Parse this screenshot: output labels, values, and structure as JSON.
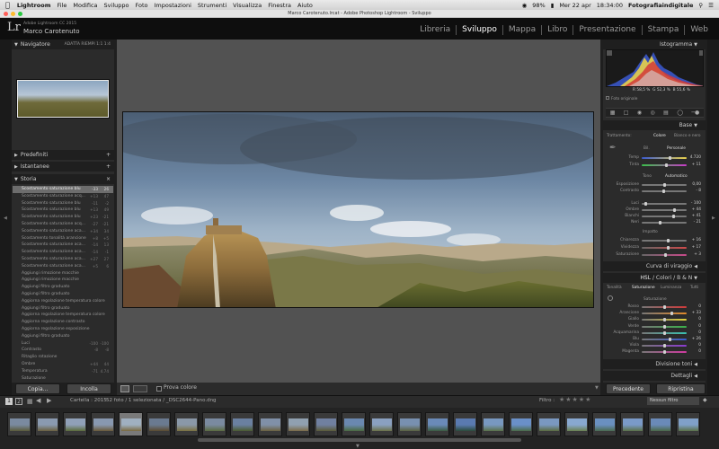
{
  "menubar": {
    "apple": "",
    "app": "Lightroom",
    "items": [
      "File",
      "Modifica",
      "Sviluppo",
      "Foto",
      "Impostazioni",
      "Strumenti",
      "Visualizza",
      "Finestra",
      "Aiuto"
    ],
    "right": {
      "battery": "98%",
      "date": "Mer 22 apr",
      "time": "18:34:00",
      "user": "Fotografiaindigitale"
    }
  },
  "window": {
    "title": "Marco Carotenuto.lrcat - Adobe Photoshop Lightroom - Sviluppo"
  },
  "identity": {
    "logo": "Lr",
    "version": "Adobe Lightroom CC 2015",
    "name": "Marco Carotenuto"
  },
  "modules": [
    "Libreria",
    "Sviluppo",
    "Mappa",
    "Libro",
    "Presentazione",
    "Stampa",
    "Web"
  ],
  "left": {
    "navigator": {
      "title": "Navigatore",
      "opts": "ADATTA  RIEMPI  1:1  1:4"
    },
    "presets": {
      "title": "Predefiniti"
    },
    "snapshots": {
      "title": "Istantanee"
    },
    "history": {
      "title": "Storia",
      "items": [
        {
          "label": "Scostamento saturazione blu",
          "v1": "-33",
          "v2": "26"
        },
        {
          "label": "Scostamento saturazione acq...",
          "v1": "+13",
          "v2": "47"
        },
        {
          "label": "Scostamento saturazione blu",
          "v1": "-11",
          "v2": "-2"
        },
        {
          "label": "Scostamento saturazione blu",
          "v1": "+13",
          "v2": "49"
        },
        {
          "label": "Scostamento saturazione blu",
          "v1": "+23",
          "v2": "-21"
        },
        {
          "label": "Scostamento saturazione acq...",
          "v1": "-27",
          "v2": "-21"
        },
        {
          "label": "Scostamento saturazione aca...",
          "v1": "+34",
          "v2": "34"
        },
        {
          "label": "Scostamento tonalità arancione",
          "v1": "+8",
          "v2": "+5"
        },
        {
          "label": "Scostamento saturazione aca...",
          "v1": "-14",
          "v2": "13"
        },
        {
          "label": "Scostamento saturazione aca...",
          "v1": "-14",
          "v2": "-1"
        },
        {
          "label": "Scostamento saturazione aca...",
          "v1": "+27",
          "v2": "27"
        },
        {
          "label": "Scostamento saturazione aca...",
          "v1": "+5",
          "v2": "6"
        },
        {
          "label": "Aggiungi rimozione macchie",
          "v1": "",
          "v2": ""
        },
        {
          "label": "Aggiungi rimozione macchie",
          "v1": "",
          "v2": ""
        },
        {
          "label": "Aggiungi filtro graduato",
          "v1": "",
          "v2": ""
        },
        {
          "label": "Aggiungi filtro graduato",
          "v1": "",
          "v2": ""
        },
        {
          "label": "Aggiorna regolazione temperatura colore",
          "v1": "",
          "v2": ""
        },
        {
          "label": "Aggiungi filtro graduato",
          "v1": "",
          "v2": ""
        },
        {
          "label": "Aggiorna regolazione temperatura colore",
          "v1": "",
          "v2": ""
        },
        {
          "label": "Aggiorna regolazione contrasto",
          "v1": "",
          "v2": ""
        },
        {
          "label": "Aggiorna regolazione esposizione",
          "v1": "",
          "v2": ""
        },
        {
          "label": "Aggiungi filtro graduato",
          "v1": "",
          "v2": ""
        },
        {
          "label": "Luci",
          "v1": "-100",
          "v2": "-100"
        },
        {
          "label": "Contrasto",
          "v1": "-8",
          "v2": "-8"
        },
        {
          "label": "Ritaglio rotazione",
          "v1": "",
          "v2": ""
        },
        {
          "label": "Ombre",
          "v1": "+44",
          "v2": "44"
        },
        {
          "label": "Temperatura",
          "v1": "-71",
          "v2": "4.74"
        },
        {
          "label": "Saturazione",
          "v1": "",
          "v2": ""
        }
      ]
    },
    "copy": "Copia...",
    "paste": "Incolla"
  },
  "toolbar": {
    "proof": "Prova colore"
  },
  "right": {
    "histogram": {
      "title": "Istogramma",
      "r": "58,5",
      "g": "52,3",
      "b": "55,6",
      "orig": "Foto originale"
    },
    "basic": {
      "title": "Base",
      "treatment": "Trattamento:",
      "color": "Colore",
      "bw": "Bianco e nero",
      "wb_label": "Bil.",
      "wb_value": "Personale",
      "temp": {
        "label": "Temp",
        "value": "4.720"
      },
      "tint": {
        "label": "Tinta",
        "value": "+ 11"
      },
      "tone_label": "Tono",
      "auto": "Automatico",
      "exposure": {
        "label": "Esposizione",
        "value": "0,00"
      },
      "contrast": {
        "label": "Contrasto",
        "value": "- 8"
      },
      "highlights": {
        "label": "Luci",
        "value": "- 100"
      },
      "shadows": {
        "label": "Ombre",
        "value": "+ 44"
      },
      "whites": {
        "label": "Bianchi",
        "value": "+ 41"
      },
      "blacks": {
        "label": "Neri",
        "value": "- 21"
      },
      "presence_label": "Impatto",
      "clarity": {
        "label": "Chiarezza",
        "value": "+ 16"
      },
      "vibrance": {
        "label": "Vividezza",
        "value": "+ 17"
      },
      "saturation": {
        "label": "Saturazione",
        "value": "+ 3"
      }
    },
    "curve": {
      "title": "Curva di viraggio"
    },
    "hsl": {
      "title_hsl": "HSL",
      "title_colors": "Colori",
      "title_bw": "B & N",
      "tabs": [
        "Tonalità",
        "Saturazione",
        "Luminanza",
        "Tutti"
      ],
      "sub": "Saturazione",
      "rows": [
        {
          "label": "Rosso",
          "value": "0"
        },
        {
          "label": "Arancione",
          "value": "+ 33"
        },
        {
          "label": "Giallo",
          "value": "0"
        },
        {
          "label": "Verde",
          "value": "0"
        },
        {
          "label": "Acquamarina",
          "value": "0"
        },
        {
          "label": "Blu",
          "value": "+ 26"
        },
        {
          "label": "Viola",
          "value": "0"
        },
        {
          "label": "Magenta",
          "value": "0"
        }
      ]
    },
    "split": {
      "title": "Divisione toni"
    },
    "detail": {
      "title": "Dettagli"
    },
    "prev": "Precedente",
    "reset": "Ripristina (Adobe)"
  },
  "filmstrip": {
    "source": "Cartella : 2015",
    "info": "52 foto / 1 selezionata / _DSC2644-Pano.dng",
    "filter": "Filtro :",
    "filter_value": "Nessun filtro"
  }
}
